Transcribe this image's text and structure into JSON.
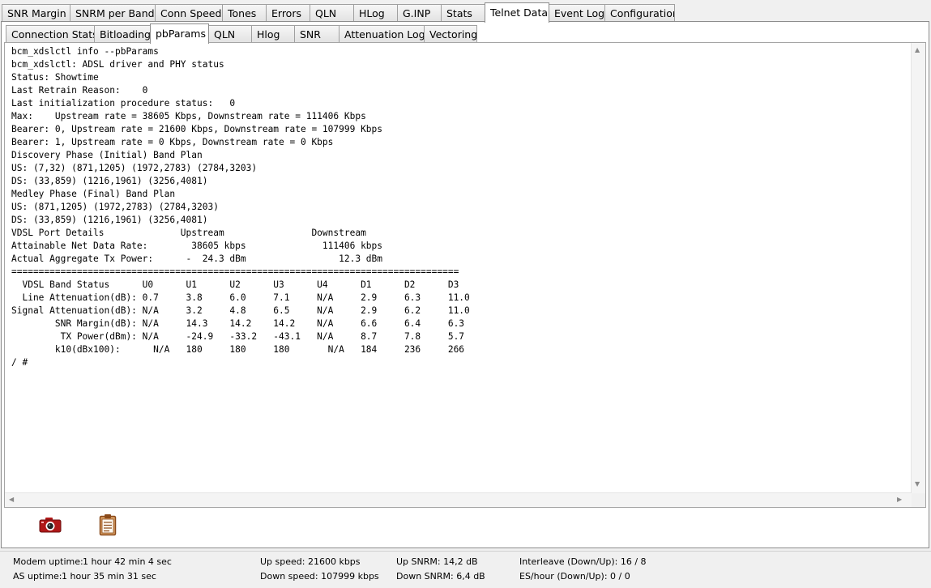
{
  "main_tabs": [
    "SNR Margin",
    "SNRM per Band",
    "Conn Speed",
    "Tones",
    "Errors",
    "QLN",
    "HLog",
    "G.INP",
    "Stats",
    "Telnet Data",
    "Event Log",
    "Configuration"
  ],
  "active_main_tab": "Telnet Data",
  "sub_tabs": [
    "Connection Stats",
    "Bitloading",
    "pbParams",
    "QLN",
    "Hlog",
    "SNR",
    "Attenuation Log",
    "Vectoring"
  ],
  "active_sub_tab": "pbParams",
  "console_lines": [
    "bcm_xdslctl info --pbParams",
    "bcm_xdslctl: ADSL driver and PHY status",
    "Status: Showtime",
    "Last Retrain Reason:    0",
    "Last initialization procedure status:   0",
    "Max:    Upstream rate = 38605 Kbps, Downstream rate = 111406 Kbps",
    "Bearer: 0, Upstream rate = 21600 Kbps, Downstream rate = 107999 Kbps",
    "Bearer: 1, Upstream rate = 0 Kbps, Downstream rate = 0 Kbps",
    "Discovery Phase (Initial) Band Plan",
    "US: (7,32) (871,1205) (1972,2783) (2784,3203)",
    "DS: (33,859) (1216,1961) (3256,4081)",
    "Medley Phase (Final) Band Plan",
    "US: (871,1205) (1972,2783) (2784,3203)",
    "DS: (33,859) (1216,1961) (3256,4081)",
    "VDSL Port Details              Upstream                Downstream",
    "Attainable Net Data Rate:        38605 kbps              111406 kbps",
    "Actual Aggregate Tx Power:      -  24.3 dBm                 12.3 dBm",
    "==================================================================================",
    "  VDSL Band Status      U0      U1      U2      U3      U4      D1      D2      D3",
    "  Line Attenuation(dB): 0.7     3.8     6.0     7.1     N/A     2.9     6.3     11.0",
    "Signal Attenuation(dB): N/A     3.2     4.8     6.5     N/A     2.9     6.2     11.0",
    "        SNR Margin(dB): N/A     14.3    14.2    14.2    N/A     6.6     6.4     6.3",
    "         TX Power(dBm): N/A     -24.9   -33.2   -43.1   N/A     8.7     7.8     5.7",
    "        k10(dBx100):      N/A   180     180     180       N/A   184     236     266",
    "/ #"
  ],
  "toolbar": {
    "camera_icon": "camera-icon",
    "clipboard_icon": "clipboard-icon"
  },
  "status": {
    "modem_uptime_label": "Modem uptime:",
    "modem_uptime_value": "1 hour 42 min 4 sec",
    "as_uptime_label": "AS uptime:",
    "as_uptime_value": "1 hour 35 min 31 sec",
    "up_speed": "Up speed: 21600 kbps",
    "down_speed": "Down speed: 107999 kbps",
    "up_snrm": "Up SNRM: 14,2 dB",
    "down_snrm": "Down SNRM: 6,4 dB",
    "interleave": "Interleave (Down/Up): 16 / 8",
    "es_hour": "ES/hour (Down/Up): 0 / 0"
  },
  "colors": {
    "camera": "#b01818",
    "clipboard": "#8a4a1a",
    "panel_border": "#8c8c8c"
  }
}
